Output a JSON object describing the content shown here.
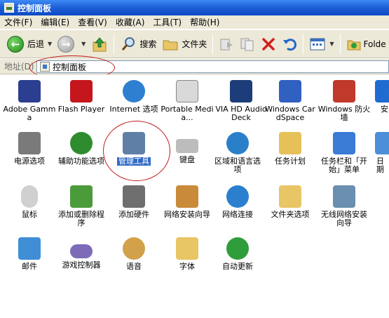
{
  "window": {
    "title": "控制面板"
  },
  "menu": [
    "文件(F)",
    "编辑(E)",
    "查看(V)",
    "收藏(A)",
    "工具(T)",
    "帮助(H)"
  ],
  "toolbar": {
    "back": "后退",
    "search": "搜索",
    "folders": "文件夹",
    "folder_cut": "Folde"
  },
  "address": {
    "label": "地址(D)",
    "value": "控制面板"
  },
  "items": [
    {
      "label": "Adobe Gamma",
      "icon": "monitor-icon",
      "color": "#2c3e8f"
    },
    {
      "label": "Flash Player",
      "icon": "flash-icon",
      "color": "#c4161c"
    },
    {
      "label": "Internet 选项",
      "icon": "internet-globe-icon",
      "color": "#2d7fd0"
    },
    {
      "label": "Portable Media...",
      "icon": "media-player-icon",
      "color": "#d9d9d9"
    },
    {
      "label": "VIA HD Audio Deck",
      "icon": "audio-deck-icon",
      "color": "#1d3c7a"
    },
    {
      "label": "Windows CardSpace",
      "icon": "cardspace-icon",
      "color": "#3060c0"
    },
    {
      "label": "Windows 防火墙",
      "icon": "firewall-icon",
      "color": "#c0392b"
    },
    {
      "label": "安",
      "icon": "security-icon",
      "color": "#1f6bd0"
    },
    {
      "label": "电源选项",
      "icon": "power-icon",
      "color": "#7a7a7a"
    },
    {
      "label": "辅助功能选项",
      "icon": "accessibility-icon",
      "color": "#2e8b2e"
    },
    {
      "label": "管理工具",
      "icon": "admin-tools-icon",
      "color": "#5f7fa6"
    },
    {
      "label": "键盘",
      "icon": "keyboard-icon",
      "color": "#bcbcbc"
    },
    {
      "label": "区域和语言选项",
      "icon": "region-globe-icon",
      "color": "#2a7fc9"
    },
    {
      "label": "任务计划",
      "icon": "scheduled-tasks-icon",
      "color": "#e6c15a"
    },
    {
      "label": "任务栏和「开始」菜单",
      "icon": "taskbar-icon",
      "color": "#3a7bd5"
    },
    {
      "label": "日期",
      "icon": "date-icon",
      "color": "#4b8fd8"
    },
    {
      "label": "鼠标",
      "icon": "mouse-icon",
      "color": "#d0d0d0"
    },
    {
      "label": "添加或删除程序",
      "icon": "add-remove-icon",
      "color": "#4c9b3a"
    },
    {
      "label": "添加硬件",
      "icon": "add-hardware-icon",
      "color": "#6f6f6f"
    },
    {
      "label": "网络安装向导",
      "icon": "network-wizard-icon",
      "color": "#c98a3a"
    },
    {
      "label": "网络连接",
      "icon": "network-connections-icon",
      "color": "#2b7fcf"
    },
    {
      "label": "文件夹选项",
      "icon": "folder-options-icon",
      "color": "#e8c565"
    },
    {
      "label": "无线网络安装向导",
      "icon": "wireless-wizard-icon",
      "color": "#6a8fb0"
    },
    {
      "label": "邮件",
      "icon": "mail-icon",
      "color": "#3f8ed6"
    },
    {
      "label": "游戏控制器",
      "icon": "game-controller-icon",
      "color": "#7d6bb8"
    },
    {
      "label": "语音",
      "icon": "speech-icon",
      "color": "#d2a14a"
    },
    {
      "label": "字体",
      "icon": "fonts-icon",
      "color": "#e8c565"
    },
    {
      "label": "自动更新",
      "icon": "windows-update-icon",
      "color": "#2f9e3a"
    }
  ]
}
